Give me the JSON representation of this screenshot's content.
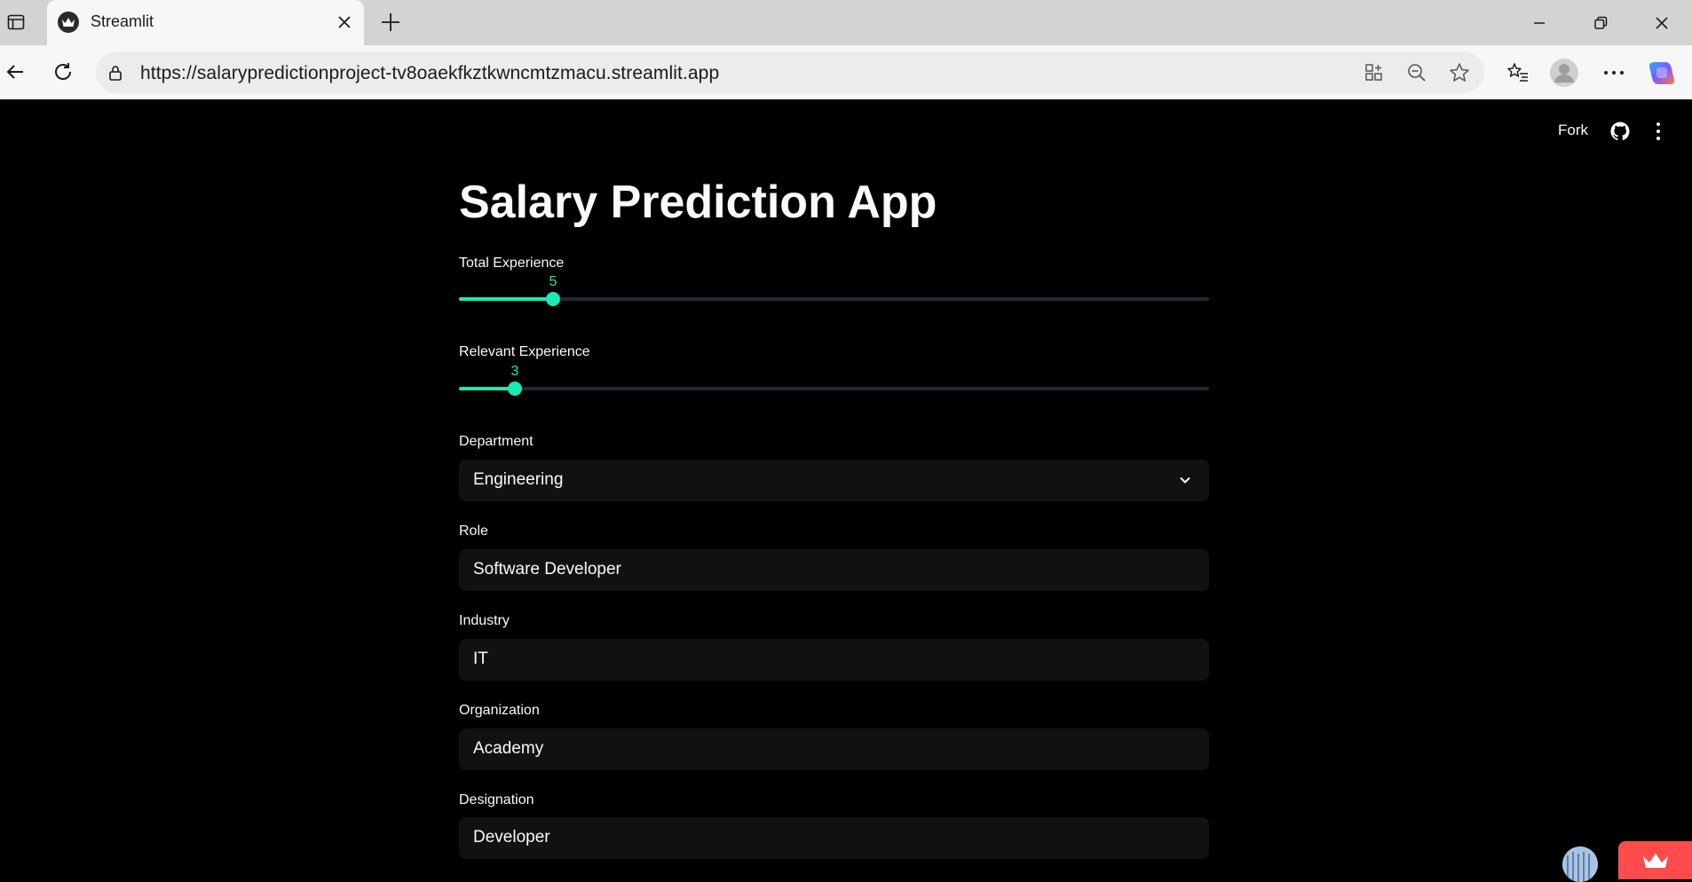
{
  "browser": {
    "tab_title": "Streamlit",
    "url": "https://salarypredictionproject-tv8oaekfkztkwncmtzmacu.streamlit.app",
    "icons": {
      "tab_actions": "tab-actions-icon",
      "favicon": "streamlit-crown-icon",
      "close_tab": "close-icon",
      "new_tab": "plus-icon",
      "minimize": "minimize-icon",
      "restore": "restore-icon",
      "close_window": "close-icon",
      "back": "back-arrow-icon",
      "reload": "reload-icon",
      "site_info": "lock-icon",
      "app_available": "app-grid-icon",
      "zoom": "zoom-out-icon",
      "favorite": "star-icon",
      "favorites": "favorites-list-icon",
      "profile": "profile-icon",
      "more": "more-dots-icon",
      "copilot": "copilot-icon"
    }
  },
  "app": {
    "header": {
      "fork_label": "Fork",
      "github_icon": "github-icon",
      "menu_icon": "kebab-menu-icon"
    },
    "title": "Salary Prediction App",
    "sliders": [
      {
        "label": "Total Experience",
        "value": "5",
        "fraction": 0.125
      },
      {
        "label": "Relevant Experience",
        "value": "3",
        "fraction": 0.075
      }
    ],
    "department": {
      "label": "Department",
      "value": "Engineering"
    },
    "role": {
      "label": "Role",
      "value": "Software Developer"
    },
    "industry": {
      "label": "Industry",
      "value": "IT"
    },
    "organization": {
      "label": "Organization",
      "value": "Academy"
    },
    "designation": {
      "label": "Designation",
      "value": "Developer"
    }
  },
  "colors": {
    "accent": "#1de9b6",
    "background": "#000000",
    "input_bg": "#111111",
    "streamlit_red": "#ff4b4b"
  }
}
